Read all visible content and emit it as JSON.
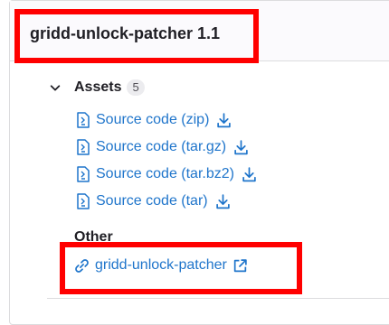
{
  "release": {
    "title": "gridd-unlock-patcher 1.1"
  },
  "assets": {
    "label": "Assets",
    "count": "5",
    "sources": [
      {
        "label": "Source code (zip)"
      },
      {
        "label": "Source code (tar.gz)"
      },
      {
        "label": "Source code (tar.bz2)"
      },
      {
        "label": "Source code (tar)"
      }
    ],
    "other": {
      "label": "Other",
      "links": [
        {
          "label": "gridd-unlock-patcher"
        }
      ]
    }
  },
  "colors": {
    "link": "#1f75cb",
    "highlight": "#ff0000",
    "text": "#1f1e24"
  },
  "icons": {
    "toggle": "chevron-down-icon",
    "file": "file-zip-icon",
    "download": "download-icon",
    "link": "link-icon",
    "external": "external-link-icon"
  }
}
